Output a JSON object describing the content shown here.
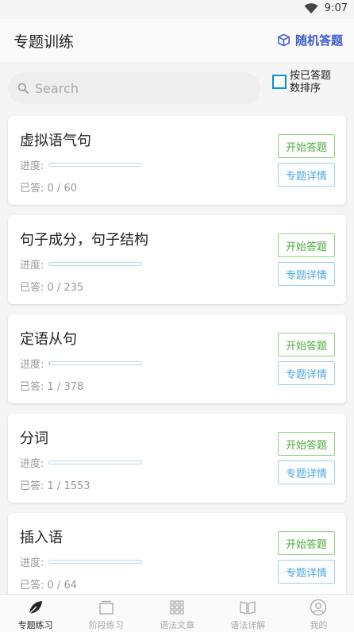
{
  "status_bar": {
    "time": "9:07",
    "wifi_icon": "wifi-icon"
  },
  "header": {
    "title": "专题训练",
    "random_label": "随机答题",
    "random_icon": "cube-icon",
    "accent_color": "#3b5bcc"
  },
  "search": {
    "placeholder": "Search",
    "value": ""
  },
  "sort": {
    "label": "按已答题数排序",
    "checked": false
  },
  "topics": [
    {
      "title": "虚拟语气句",
      "progress_label": "进度:",
      "answered_label": "已答:",
      "answered": 0,
      "total": 60,
      "answered_text": "0 / 60",
      "start_label": "开始答题",
      "detail_label": "专题详情"
    },
    {
      "title": "句子成分，句子结构",
      "progress_label": "进度:",
      "answered_label": "已答:",
      "answered": 0,
      "total": 235,
      "answered_text": "0 / 235",
      "start_label": "开始答题",
      "detail_label": "专题详情"
    },
    {
      "title": "定语从句",
      "progress_label": "进度:",
      "answered_label": "已答:",
      "answered": 1,
      "total": 378,
      "answered_text": "1 / 378",
      "start_label": "开始答题",
      "detail_label": "专题详情"
    },
    {
      "title": "分词",
      "progress_label": "进度:",
      "answered_label": "已答:",
      "answered": 1,
      "total": 1553,
      "answered_text": "1 / 1553",
      "start_label": "开始答题",
      "detail_label": "专题详情"
    },
    {
      "title": "插入语",
      "progress_label": "进度:",
      "answered_label": "已答:",
      "answered": 0,
      "total": 64,
      "answered_text": "0 / 64",
      "start_label": "开始答题",
      "detail_label": "专题详情"
    }
  ],
  "bottom_nav": [
    {
      "label": "专题练习",
      "icon": "leaf-icon",
      "active": true
    },
    {
      "label": "阶段练习",
      "icon": "stack-icon",
      "active": false
    },
    {
      "label": "语法文章",
      "icon": "grid-icon",
      "active": false
    },
    {
      "label": "语法详解",
      "icon": "book-icon",
      "active": false
    },
    {
      "label": "我的",
      "icon": "user-icon",
      "active": false
    }
  ]
}
